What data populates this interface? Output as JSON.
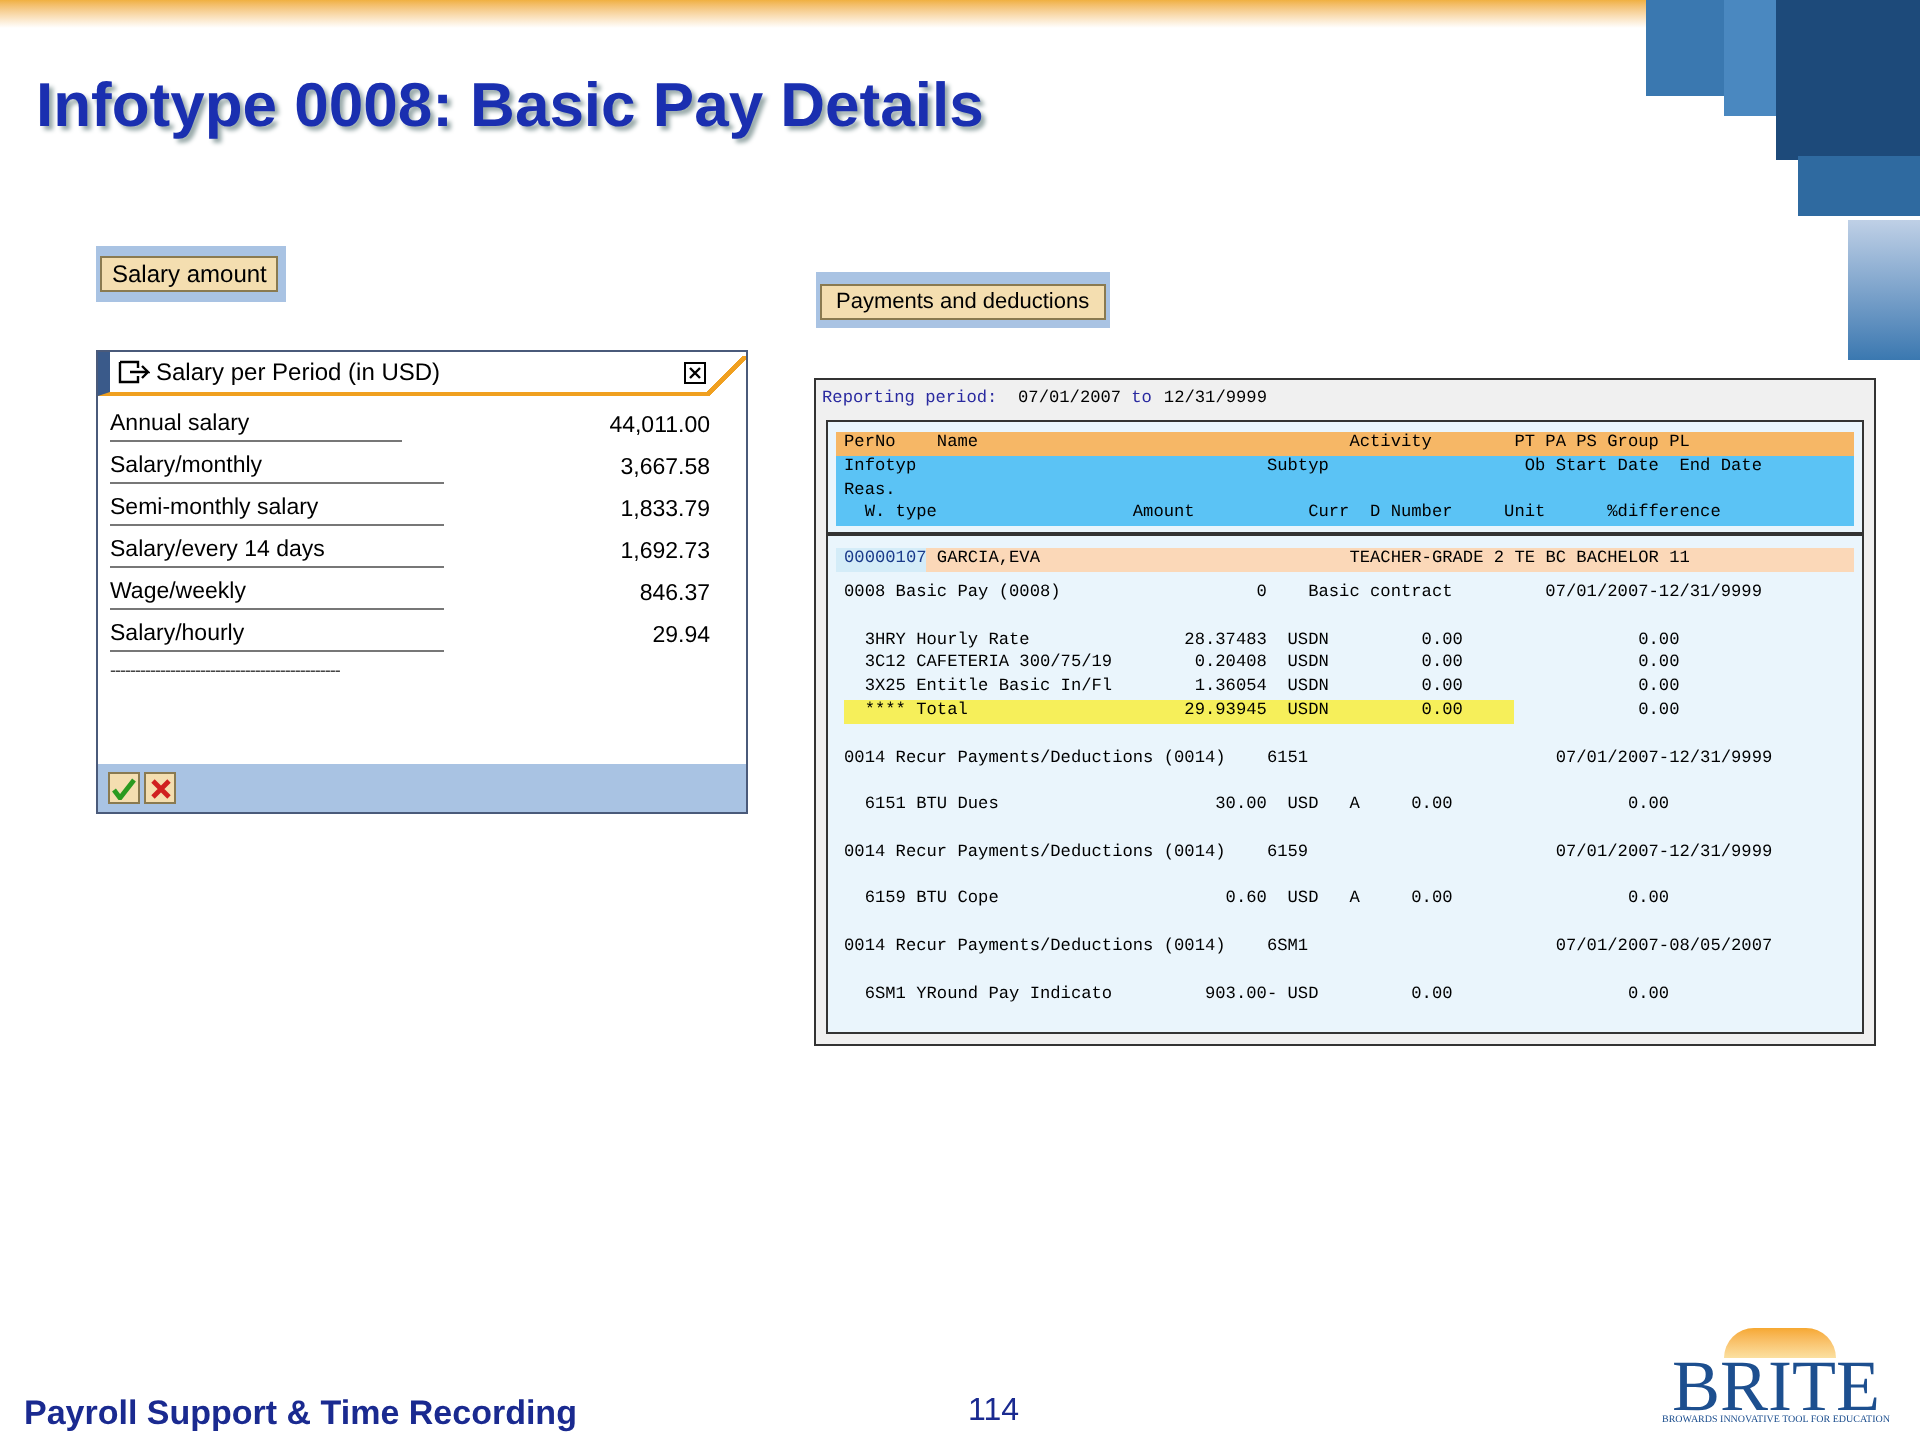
{
  "title": "Infotype 0008: Basic Pay Details",
  "salary_button": "Salary amount",
  "dialog": {
    "title": "Salary per Period (in USD)",
    "rows": [
      {
        "kind": "amount",
        "label": "Annual salary",
        "value": "44,011.00"
      },
      {
        "kind": "amount",
        "label": "Salary/monthly",
        "value": "3,667.58"
      },
      {
        "kind": "amount",
        "label": "Semi-monthly salary",
        "value": "1,833.79"
      },
      {
        "kind": "amount",
        "label": "Salary/every 14 days",
        "value": "1,692.73"
      },
      {
        "kind": "amount",
        "label": "Wage/weekly",
        "value": "846.37"
      },
      {
        "kind": "amount",
        "label": "Salary/hourly",
        "value": "29.94"
      },
      {
        "kind": "separator",
        "label": "----------------------------------------------"
      }
    ]
  },
  "payments_button": "Payments and deductions",
  "report": {
    "period_label": "Reporting period:",
    "period_from": "07/01/2007",
    "period_to_word": "to",
    "period_to": "12/31/9999",
    "header": [
      {
        "kind": "orange",
        "text": "PerNo    Name                                    Activity        PT PA PS Group PL"
      },
      {
        "kind": "blue",
        "text": "Infotyp                                  Subtyp                   Ob Start Date  End Date"
      },
      {
        "kind": "blue",
        "text": "Reas."
      },
      {
        "kind": "blue",
        "text": "  W. type                   Amount           Curr  D Number     Unit      %difference"
      }
    ],
    "person": {
      "perno": "00000107",
      "text": " GARCIA,EVA                              TEACHER-GRADE 2 TE BC BACHELOR 11"
    },
    "lines": [
      {
        "kind": "text",
        "text": "0008 Basic Pay (0008)                   0    Basic contract         07/01/2007-12/31/9999"
      },
      {
        "kind": "blank"
      },
      {
        "kind": "text",
        "text": "  3HRY Hourly Rate               28.37483  USDN         0.00                 0.00"
      },
      {
        "kind": "text",
        "text": "  3C12 CAFETERIA 300/75/19        0.20408  USDN         0.00                 0.00"
      },
      {
        "kind": "text",
        "text": "  3X25 Entitle Basic In/Fl        1.36054  USDN         0.00                 0.00"
      },
      {
        "kind": "total",
        "text": "  **** Total                     29.93945  USDN         0.00     ",
        "rest": "            0.00"
      },
      {
        "kind": "blank"
      },
      {
        "kind": "text",
        "text": "0014 Recur Payments/Deductions (0014)    6151                        07/01/2007-12/31/9999"
      },
      {
        "kind": "blank"
      },
      {
        "kind": "text",
        "text": "  6151 BTU Dues                     30.00  USD   A     0.00                 0.00"
      },
      {
        "kind": "blank"
      },
      {
        "kind": "text",
        "text": "0014 Recur Payments/Deductions (0014)    6159                        07/01/2007-12/31/9999"
      },
      {
        "kind": "blank"
      },
      {
        "kind": "text",
        "text": "  6159 BTU Cope                      0.60  USD   A     0.00                 0.00"
      },
      {
        "kind": "blank"
      },
      {
        "kind": "text",
        "text": "0014 Recur Payments/Deductions (0014)    6SM1                        07/01/2007-08/05/2007"
      },
      {
        "kind": "blank"
      },
      {
        "kind": "text",
        "text": "  6SM1 YRound Pay Indicato         903.00- USD         0.00                 0.00"
      }
    ]
  },
  "footer": {
    "left": "Payroll Support & Time Recording",
    "page": "114"
  },
  "logo": {
    "name": "BRITE",
    "tagline": "BROWARDS INNOVATIVE TOOL FOR EDUCATION"
  }
}
